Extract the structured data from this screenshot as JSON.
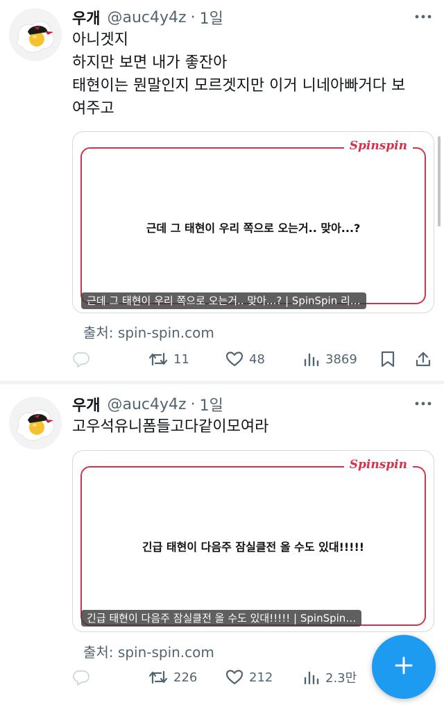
{
  "tweets": [
    {
      "name": "우개",
      "handle": "@auc4y4z",
      "separator": "·",
      "time": "1일",
      "lines": [
        "아니겟지",
        "하지만 보면 내가 좋잔아",
        "태현이는 뭔말인지 모르겟지만 이거 니네아빠거다 보",
        "여주고"
      ],
      "card": {
        "brand": "Spinspin",
        "headline": "근데 그 태현이 우리 쪽으로 오는거.. 맞아...?",
        "caption": "근데 그 태현이 우리 쪽으로 오는거.. 맞아...? | SpinSpin 리…"
      },
      "source": "출처: spin-spin.com",
      "stats": {
        "reply": "",
        "retweet": "11",
        "like": "48",
        "views": "3869"
      }
    },
    {
      "name": "우개",
      "handle": "@auc4y4z",
      "separator": "·",
      "time": "1일",
      "lines": [
        "고우석유니폼들고다같이모여라"
      ],
      "card": {
        "brand": "Spinspin",
        "headline": "긴급 태현이 다음주 잠실클전 올 수도 있대!!!!!",
        "caption": "긴급 태현이 다음주 잠실클전 올 수도 있대!!!!! | SpinSpin…"
      },
      "source": "출처: spin-spin.com",
      "stats": {
        "reply": "",
        "retweet": "226",
        "like": "212",
        "views": "2.3만"
      }
    }
  ],
  "colors": {
    "accent": "#1d9bf0",
    "text_primary": "#0f1419",
    "text_secondary": "#536471",
    "card_border": "#d7314a"
  },
  "icons": [
    "more-icon",
    "reply-icon",
    "retweet-icon",
    "like-icon",
    "views-icon",
    "bookmark-icon",
    "share-icon",
    "compose-plus-icon"
  ]
}
